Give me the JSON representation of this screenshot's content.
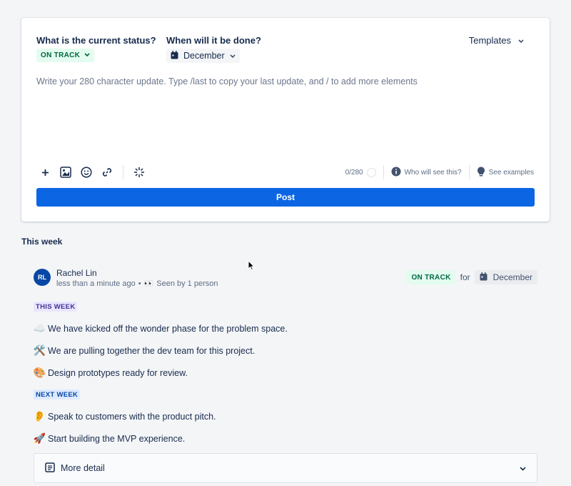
{
  "composer": {
    "status_question": "What is the current status?",
    "status_value": "ON TRACK",
    "date_question": "When will it be done?",
    "date_value": "December",
    "templates_label": "Templates",
    "editor_placeholder": "Write your 280 character update. Type /last to copy your last update, and / to add more elements",
    "char_count": "0/280",
    "who_sees": "Who will see this?",
    "see_examples": "See examples",
    "post_label": "Post"
  },
  "feed": {
    "section_title": "This week",
    "update": {
      "avatar_initials": "RL",
      "author": "Rachel Lin",
      "time": "less than a minute ago",
      "separator": "•",
      "seen_emoji": "👀",
      "seen_by": "Seen by 1 person",
      "status": "ON TRACK",
      "for_word": "for",
      "date": "December",
      "this_week_tag": "THIS WEEK",
      "this_week_items": [
        {
          "emoji": "☁️",
          "text": "We have kicked off the wonder phase for the problem space."
        },
        {
          "emoji": "🛠️",
          "text": "We are pulling together the dev team for this project."
        },
        {
          "emoji": "🎨",
          "text": "Design prototypes ready for review."
        }
      ],
      "next_week_tag": "NEXT WEEK",
      "next_week_items": [
        {
          "emoji": "👂",
          "text": "Speak to customers with the product pitch."
        },
        {
          "emoji": "🚀",
          "text": "Start building the MVP experience."
        }
      ],
      "more_detail": "More detail"
    }
  },
  "colors": {
    "primary": "#0c66e4",
    "on_track_bg": "#e3fcef",
    "on_track_text": "#006644",
    "this_week_bg": "#eae6ff",
    "next_week_bg": "#deebff"
  }
}
